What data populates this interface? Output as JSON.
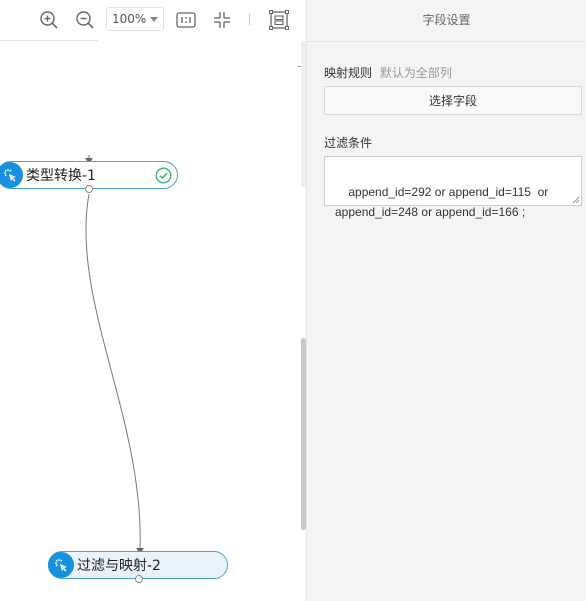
{
  "toolbar": {
    "zoom_value": "100%",
    "icons": [
      "zoom-in-icon",
      "zoom-out-icon",
      "actual-size-icon",
      "fit-screen-icon",
      "minimap-icon"
    ]
  },
  "canvas": {
    "nodes": [
      {
        "label": "类型转换-1",
        "status": "success",
        "icon": "pointer-click-icon"
      },
      {
        "label": "过滤与映射-2",
        "status": "selected",
        "icon": "pointer-click-icon"
      }
    ]
  },
  "panel": {
    "title": "字段设置",
    "mapping_label": "映射规则",
    "mapping_hint": "默认为全部列",
    "select_button": "选择字段",
    "filter_label": "过滤条件",
    "filter_value": "append_id=292 or append_id=115  or\nappend_id=248 or append_id=166 ;"
  },
  "colors": {
    "accent": "#1890e0",
    "success": "#3cb371",
    "panel_bg": "#f4f4f4"
  }
}
